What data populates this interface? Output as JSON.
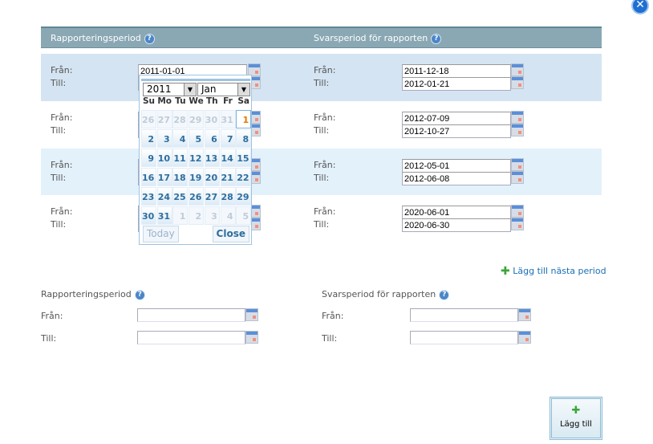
{
  "header": {
    "report_period": "Rapporteringsperiod",
    "response_period": "Svarsperiod för rapporten",
    "help_icon": "?"
  },
  "labels": {
    "from": "Från:",
    "to": "Till:"
  },
  "rows": [
    {
      "report_from": "2011-01-01",
      "report_to": "",
      "resp_from": "2011-12-18",
      "resp_to": "2012-01-21"
    },
    {
      "report_from": "",
      "report_to": "",
      "resp_from": "2012-07-09",
      "resp_to": "2012-10-27"
    },
    {
      "report_from": "",
      "report_to": "",
      "resp_from": "2012-05-01",
      "resp_to": "2012-06-08"
    },
    {
      "report_from": "",
      "report_to": "",
      "resp_from": "2020-06-01",
      "resp_to": "2020-06-30"
    }
  ],
  "datepicker": {
    "year": "2011",
    "month": "Jan",
    "weekdays": [
      "Su",
      "Mo",
      "Tu",
      "We",
      "Th",
      "Fr",
      "Sa"
    ],
    "days": [
      [
        "26",
        "27",
        "28",
        "29",
        "30",
        "31",
        "1"
      ],
      [
        "2",
        "3",
        "4",
        "5",
        "6",
        "7",
        "8"
      ],
      [
        "9",
        "10",
        "11",
        "12",
        "13",
        "14",
        "15"
      ],
      [
        "16",
        "17",
        "18",
        "19",
        "20",
        "21",
        "22"
      ],
      [
        "23",
        "24",
        "25",
        "26",
        "27",
        "28",
        "29"
      ],
      [
        "30",
        "31",
        "1",
        "2",
        "3",
        "4",
        "5"
      ]
    ],
    "selected": "1",
    "today_label": "Today",
    "close_label": "Close"
  },
  "add_next_period": "Lägg till nästa period",
  "new_period": {
    "report_period": "Rapporteringsperiod",
    "response_period": "Svarsperiod för rapporten",
    "from": "Från:",
    "to": "Till:"
  },
  "add_button": "Lägg till",
  "close_icon": "✕",
  "colors": {
    "header": "#8aa8b4",
    "row_alt1": "#d4e4f2",
    "row_alt2": "#e3f1fb",
    "link": "#1b6fb5"
  }
}
